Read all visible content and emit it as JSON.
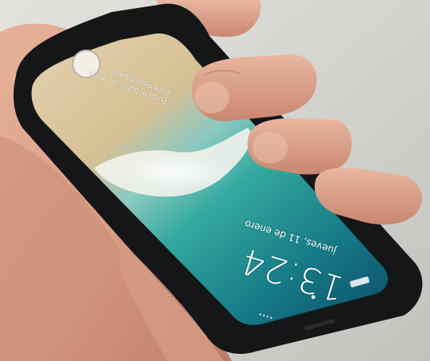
{
  "lock_screen": {
    "time": "13:24",
    "date": "jueves, 11 de enero",
    "unlock_hint": "Pulsa el botón de inicio\npara desbloquear"
  },
  "colors": {
    "background": "#cfd0cc",
    "phone_body": "#141618",
    "screen_sand": "#d8c7a2",
    "screen_sea_shallow": "#39b3a6",
    "screen_sea_deep": "#0e5f75",
    "skin": "#d9a088",
    "skin_shadow": "#b97b66"
  }
}
